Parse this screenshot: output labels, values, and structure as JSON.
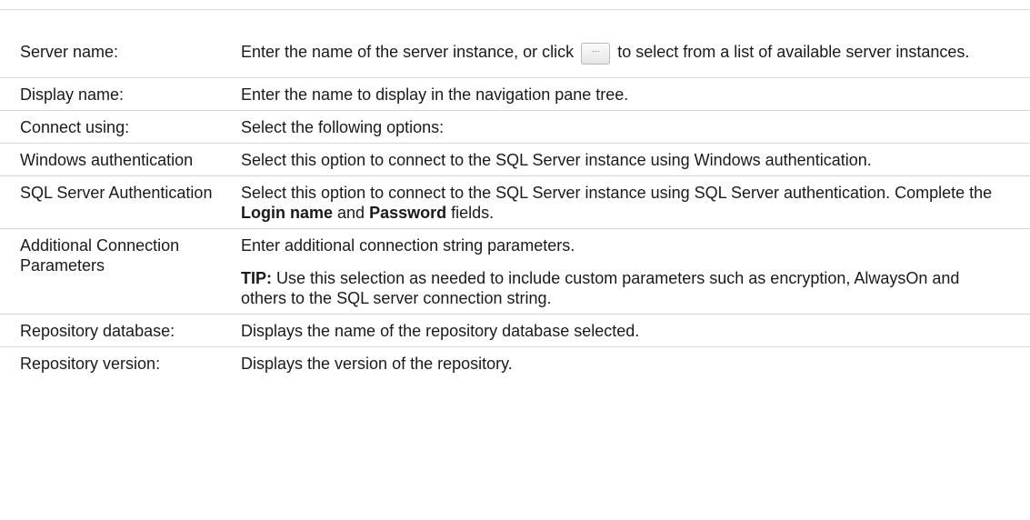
{
  "rows": [
    {
      "label": "Server name:",
      "desc_before": "Enter the name of the server instance, or click",
      "button_label": "...",
      "desc_after": "to select from a list of available server instances."
    },
    {
      "label": "Display name:",
      "desc": "Enter the name to display in the navigation pane tree."
    },
    {
      "label": "Connect using:",
      "desc": "Select the following options:"
    },
    {
      "label": "Windows authentication",
      "desc": "Select this option to connect to the SQL Server instance using Windows authentication."
    },
    {
      "label": "SQL Server Authentication",
      "desc_before": "Select this option to connect to the SQL Server instance using SQL Server authentication. Complete the",
      "bold1": "Login name",
      "desc_mid": "and",
      "bold2": "Password",
      "desc_after": "fields."
    },
    {
      "label": "Additional Connection Parameters",
      "desc": "Enter additional connection string parameters.",
      "tip_label": "TIP:",
      "tip_text": "Use this selection as needed to include custom parameters such as encryption, AlwaysOn and others to the SQL server connection string."
    },
    {
      "label": "Repository database:",
      "desc": "Displays the name of the repository database selected."
    },
    {
      "label": "Repository version:",
      "desc": "Displays the version of the repository."
    }
  ]
}
